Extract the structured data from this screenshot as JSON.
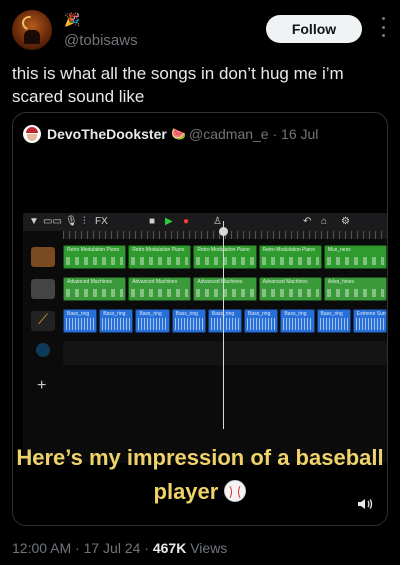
{
  "post": {
    "author_emoji": "🎉",
    "handle": "@tobisaws",
    "follow_label": "Follow",
    "text": "this is what all the songs in don’t hug me i’m scared sound like"
  },
  "quoted": {
    "name": "DevoTheDookster",
    "name_emoji": "🍉",
    "meta": "@cadman_e · 16 Jul",
    "caption": "Here’s my impression of a baseball player",
    "icons": [
      "baseball-icon",
      "volume-icon"
    ],
    "garageband": {
      "fx_label": "FX",
      "rows": [
        {
          "color": "#2f9a2e",
          "regions": [
            "Retro Modulation Piano",
            "Retro Modulation Piano",
            "Retro Modulation Piano",
            "Retro Modulation Piano",
            "Mus_ness"
          ]
        },
        {
          "color": "#3a9a3a",
          "regions": [
            "Advanced Machines",
            "Advanced Machines",
            "Advanced Machines",
            "Advanced Machines",
            "Adva_hines"
          ]
        },
        {
          "color": "#2870d8",
          "regions": [
            "Bass_ring",
            "Bass_ring",
            "Bass_ring",
            "Bass_ring",
            "Bass_ring",
            "Bass_ring",
            "Bass_ring",
            "Bass_ring",
            "Extreme Sunny"
          ]
        }
      ]
    }
  },
  "footer": {
    "time": "12:00 AM · 17 Jul 24 · ",
    "views_count": "467K",
    "views_label": " Views"
  },
  "colors": {
    "accent_caption": "#efd36a",
    "muted": "#71767b",
    "follow_bg": "#eff3f4"
  }
}
